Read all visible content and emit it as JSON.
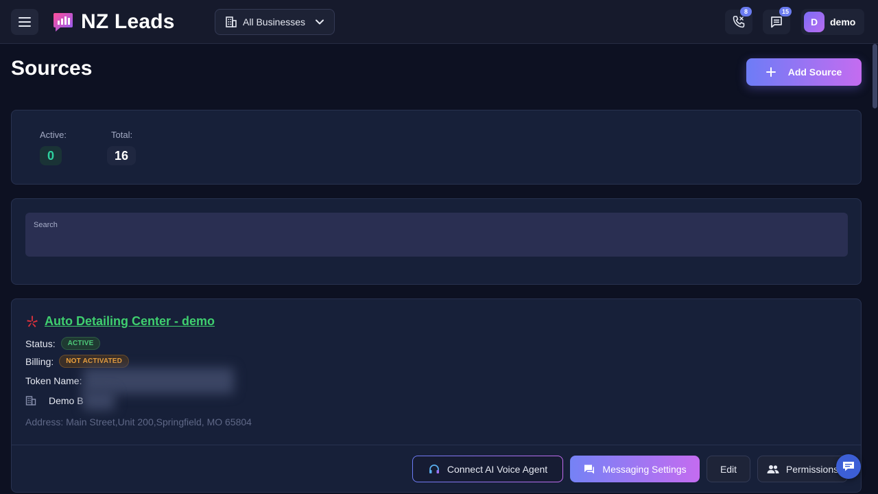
{
  "header": {
    "brand": "NZ Leads",
    "business_select": "All Businesses",
    "calls_badge": "8",
    "messages_badge": "15",
    "user_initial": "D",
    "user_name": "demo"
  },
  "page": {
    "title": "Sources",
    "add_button": "Add Source"
  },
  "stats": {
    "active_label": "Active:",
    "active_value": "0",
    "total_label": "Total:",
    "total_value": "16"
  },
  "search": {
    "label": "Search",
    "value": ""
  },
  "source": {
    "name": "Auto Detailing Center - demo",
    "status_label": "Status:",
    "status_value": "ACTIVE",
    "billing_label": "Billing:",
    "billing_value": "NOT ACTIVATED",
    "token_label": "Token Name:",
    "business_name": "Demo B",
    "address": "Address: Main Street,Unit 200,Springfield, MO 65804",
    "actions": {
      "voice": "Connect AI Voice Agent",
      "messaging": "Messaging Settings",
      "edit": "Edit",
      "permissions": "Permissions"
    }
  },
  "colors": {
    "accent_start": "#6d7cf6",
    "accent_end": "#c46cf0",
    "active_green": "#3fcf6f",
    "billing_orange": "#f0a33c"
  }
}
